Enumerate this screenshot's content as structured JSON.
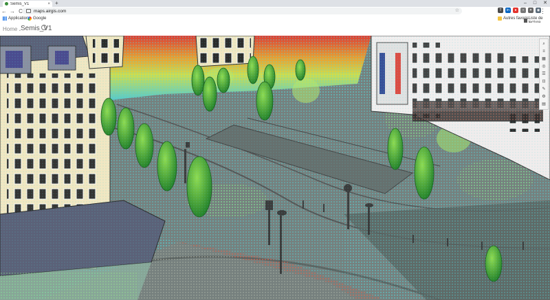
{
  "browser": {
    "tab_title": "Semis_V1",
    "tab_close": "×",
    "new_tab": "+",
    "window_controls": [
      "–",
      "□",
      "✕"
    ],
    "url": "maps.airgis.com",
    "nav": [
      "←",
      "→",
      "C"
    ],
    "star": "☆",
    "menu": "⋮",
    "extensions": [
      {
        "icon": "translate-icon",
        "color": "#4a4a4a",
        "text": "T"
      },
      {
        "icon": "linkedin-icon",
        "color": "#0a66c2",
        "text": "in"
      },
      {
        "icon": "extension-red-icon",
        "color": "#e3342f",
        "text": "●"
      },
      {
        "icon": "extension-gray-icon",
        "color": "#777777",
        "text": "▪"
      },
      {
        "icon": "puzzle-icon",
        "color": "#666666",
        "text": "✦"
      },
      {
        "icon": "profile-icon",
        "color": "#5b6b7a",
        "text": "◉"
      }
    ]
  },
  "bookmarks": {
    "apps": "Applications",
    "google": "Google",
    "other": "Autres favoris",
    "reading": "Liste de lecture"
  },
  "app": {
    "home": "Home",
    "chevron": "⌄",
    "title": "Semis_V1"
  },
  "toolbar": {
    "tools": [
      {
        "name": "zoom-icon",
        "glyph": "⌕"
      },
      {
        "name": "layers-icon",
        "glyph": "≡"
      },
      {
        "name": "grid-icon",
        "glyph": "▦"
      },
      {
        "name": "globe-icon",
        "glyph": "◎"
      },
      {
        "name": "list-icon",
        "glyph": "☰"
      },
      {
        "name": "measure-icon",
        "glyph": "⊡"
      },
      {
        "name": "wrench-icon",
        "glyph": "✎"
      },
      {
        "name": "settings-icon",
        "glyph": "⚙"
      },
      {
        "name": "table-icon",
        "glyph": "▤"
      }
    ]
  },
  "colors": {
    "pointcloud_cyan": "#4fd1d9",
    "pointcloud_green": "#8fe07a",
    "pointcloud_red": "#e04a3a",
    "tree_green": "#3aa23a",
    "building_cream": "#f1e7c2",
    "roof_slate": "#5b6178"
  }
}
